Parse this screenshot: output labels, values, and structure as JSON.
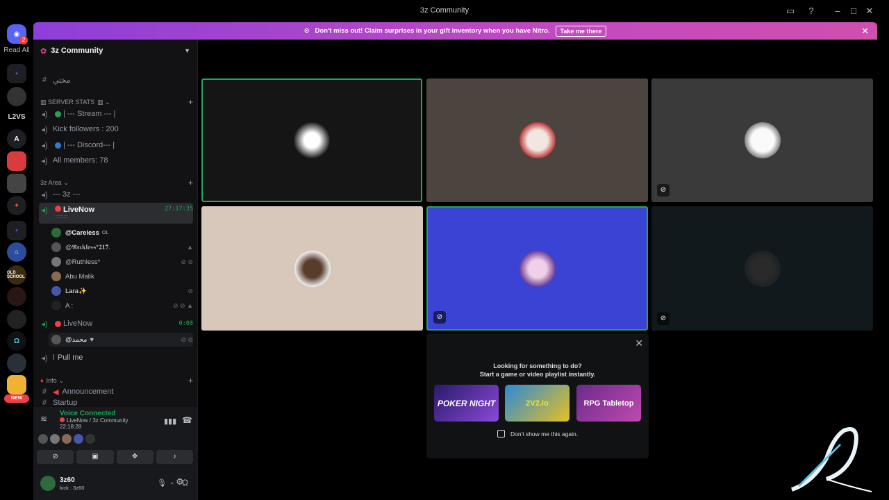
{
  "window": {
    "title": "3z Community"
  },
  "banner": {
    "text": "Don't miss out! Claim surprises in your gift inventory when you have Nitro.",
    "cta": "Take me there",
    "close": "✕"
  },
  "servers": {
    "read_all_label": "Read All",
    "badge": "2",
    "l2vs_label": "L2VS",
    "a_label": "A",
    "new_label": "NEW",
    "oldschool_label": "OLD SCHOOL"
  },
  "guild": {
    "name": "3z Community"
  },
  "channels": {
    "top_channel": "مختي",
    "cat_server_stats": "SERVER STATS",
    "stream_channel": "| --- Stream --- |",
    "kick_followers": "Kick followers : 200",
    "discord_channel": "| --- Discord--- |",
    "all_members": "All members: 78",
    "cat_3z_area": "3z Area",
    "three_z": "--- 3z ---",
    "livenow_1": "LiveNow",
    "livenow_1_time": "27:17:35",
    "livenow_1_sub": ":::::::::",
    "livenow_2": "LiveNow",
    "livenow_2_time": "0:00",
    "pull_me": "Pull me",
    "cat_info": "Info",
    "announcement": "Announcement",
    "startup": "Startup"
  },
  "members_voice_1": [
    {
      "name": "@Careless",
      "tag": "OL",
      "color": "#2d6a3e"
    },
    {
      "name": "@𝕽𝖊𝖈𝖐𝖑𝖊𝖘𝖘*𝟐𝟏𝟕.",
      "tag": "",
      "color": "#555"
    },
    {
      "name": "@Ruthless*",
      "tag": "",
      "color": "#777"
    },
    {
      "name": "Abu Malik",
      "tag": "",
      "color": "#8a6a55"
    },
    {
      "name": "Lara✨",
      "tag": "",
      "color": "#4656a8"
    },
    {
      "name": "A :",
      "tag": "",
      "color": "#222"
    }
  ],
  "members_voice_2": [
    {
      "name": "@محمد",
      "tag": "",
      "color": "#555"
    }
  ],
  "voice_panel": {
    "status": "Voice Connected",
    "channel": "LiveNow / 3z Community",
    "time": "22:18:28"
  },
  "user_panel": {
    "name": "3z60",
    "status": "kick : 3z60"
  },
  "activity": {
    "headline1": "Looking for something to do?",
    "headline2": "Start a game or video playlist instantly.",
    "cards": [
      "POKER NIGHT",
      "2V2.io",
      "RPG Tabletop"
    ],
    "checkbox_label": "Don't show me this again."
  },
  "colors": {
    "accent_green": "#23a55a",
    "tile_highlight": "#3a43d4",
    "banner": "#b34bc8"
  }
}
